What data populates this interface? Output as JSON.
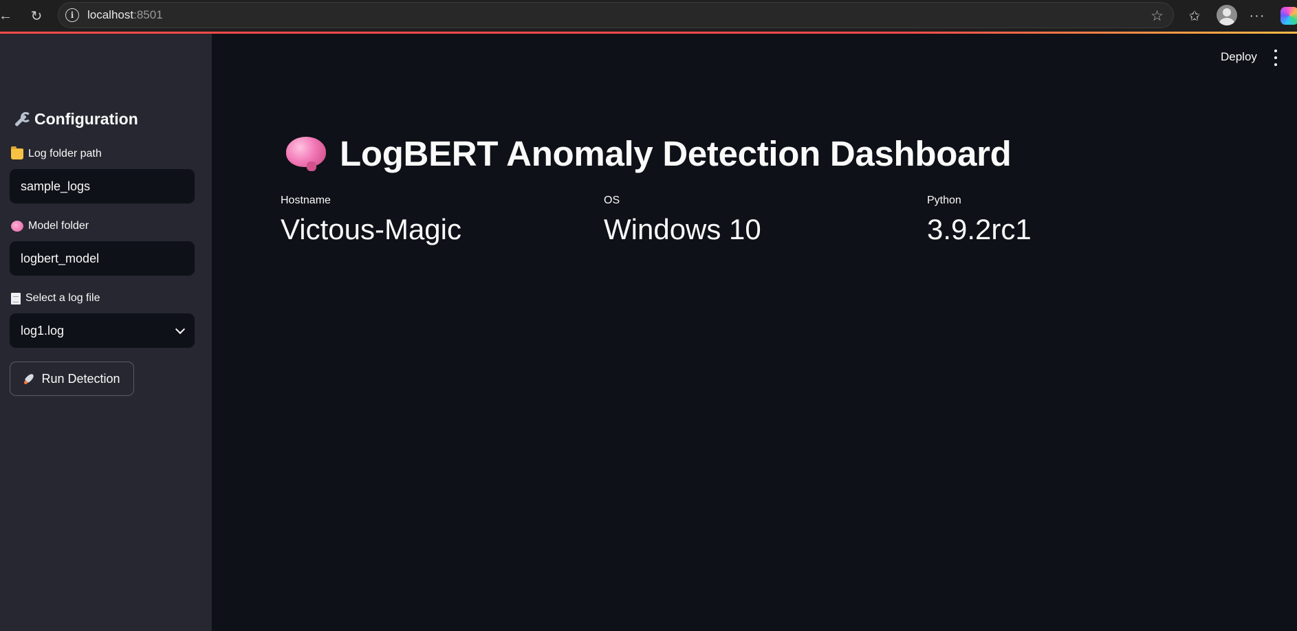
{
  "browser": {
    "url_host": "localhost",
    "url_port": ":8501"
  },
  "sidebar": {
    "title": "Configuration",
    "fields": [
      {
        "label": "Log folder path",
        "icon": "folder-icon",
        "value": "sample_logs"
      },
      {
        "label": "Model folder",
        "icon": "brain-icon",
        "value": "logbert_model"
      },
      {
        "label": "Select a log file",
        "icon": "page-icon",
        "value": "log1.log"
      }
    ],
    "run_button": "Run Detection"
  },
  "header": {
    "deploy_label": "Deploy"
  },
  "main": {
    "title": "LogBERT Anomaly Detection Dashboard",
    "metrics": [
      {
        "label": "Hostname",
        "value": "Victous-Magic"
      },
      {
        "label": "OS",
        "value": "Windows 10"
      },
      {
        "label": "Python",
        "value": "3.9.2rc1"
      }
    ]
  },
  "colors": {
    "app_background": "#0e1117",
    "sidebar_background": "#262730",
    "accent": "#ff4b4b",
    "text": "#fafafa"
  }
}
